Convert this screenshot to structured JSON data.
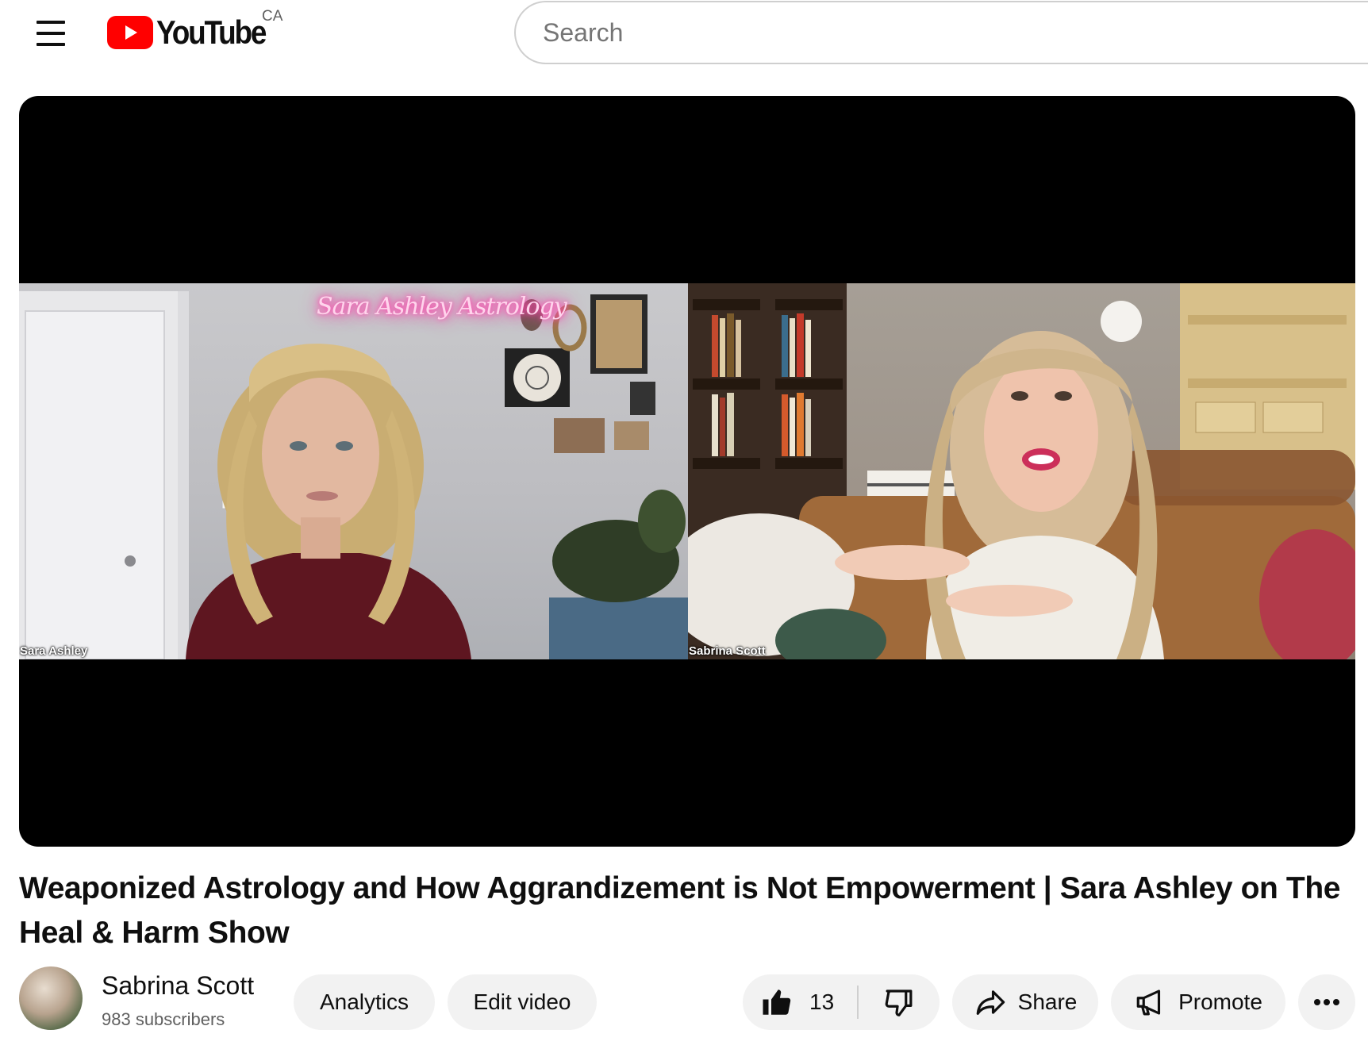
{
  "header": {
    "logo_text": "YouTube",
    "region": "CA",
    "search_placeholder": "Search"
  },
  "player": {
    "participants": [
      {
        "name": "Sara Ashley",
        "neon_sign": "Sara Ashley Astrology"
      },
      {
        "name": "Sabrina Scott"
      }
    ]
  },
  "video": {
    "title": "Weaponized Astrology and How Aggrandizement is Not Empowerment | Sara Ashley on The Heal & Harm Show"
  },
  "owner": {
    "channel_name": "Sabrina Scott",
    "subscribers": "983 subscribers"
  },
  "actions": {
    "analytics_label": "Analytics",
    "edit_label": "Edit video",
    "like_count": "13",
    "share_label": "Share",
    "promote_label": "Promote"
  },
  "icons": {
    "menu": "hamburger-menu-icon",
    "logo": "youtube-play-icon",
    "like": "thumbs-up-icon",
    "dislike": "thumbs-down-icon",
    "share": "share-arrow-icon",
    "promote": "megaphone-icon",
    "more": "more-horizontal-icon"
  },
  "colors": {
    "brand_red": "#ff0000",
    "pill_background": "#f2f2f2",
    "secondary_text": "#606060"
  }
}
